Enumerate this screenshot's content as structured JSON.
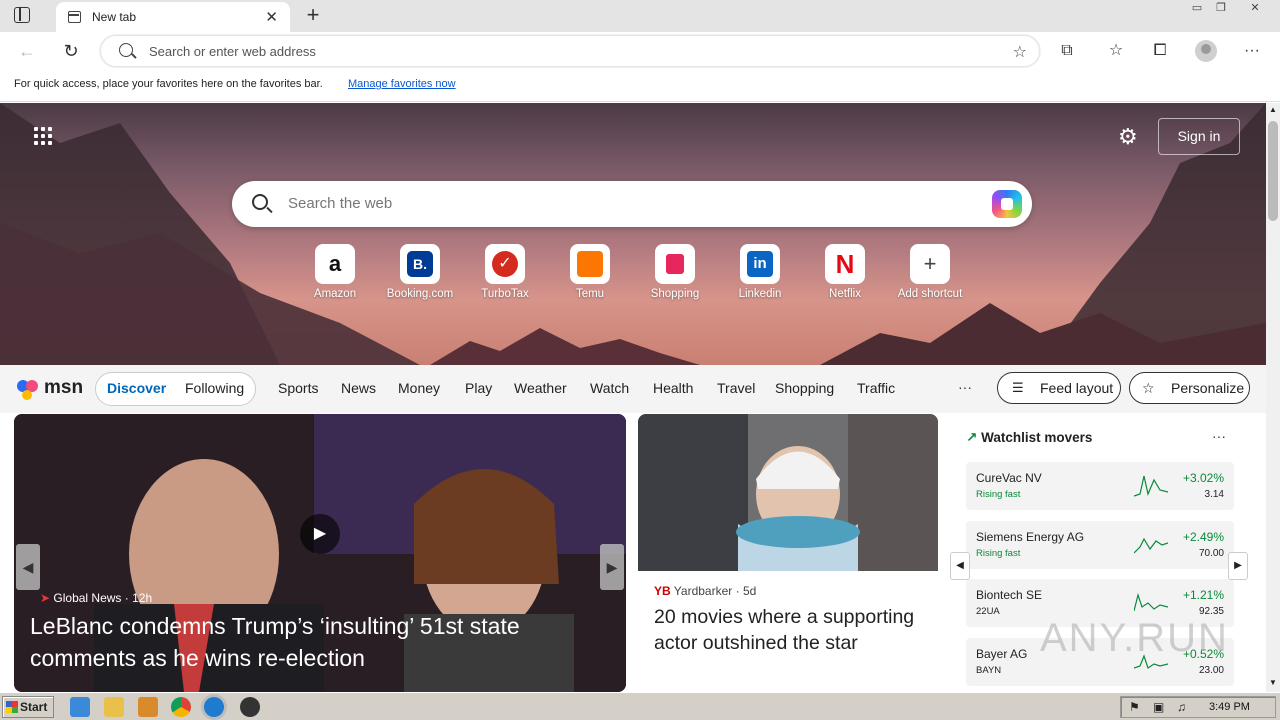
{
  "browser": {
    "tab_title": "New tab",
    "address_placeholder": "Search or enter web address",
    "favorites_message": "For quick access, place your favorites here on the favorites bar.",
    "favorites_link": "Manage favorites now"
  },
  "hero": {
    "signin_label": "Sign in",
    "search_placeholder": "Search the web",
    "shortcuts": [
      {
        "label": "Amazon",
        "icon": "amazon-icon"
      },
      {
        "label": "Booking.com",
        "icon": "booking-icon"
      },
      {
        "label": "TurboTax",
        "icon": "turbotax-icon"
      },
      {
        "label": "Temu",
        "icon": "temu-icon"
      },
      {
        "label": "Shopping",
        "icon": "shopping-bag-icon"
      },
      {
        "label": "Linkedin",
        "icon": "linkedin-icon"
      },
      {
        "label": "Netflix",
        "icon": "netflix-icon"
      },
      {
        "label": "Add shortcut",
        "icon": "plus-icon"
      }
    ]
  },
  "msn": {
    "logo_text": "msn",
    "tabs": [
      "Discover",
      "Following"
    ],
    "nav": [
      "Sports",
      "News",
      "Money",
      "Play",
      "Weather",
      "Watch",
      "Health",
      "Travel",
      "Shopping",
      "Traffic"
    ],
    "more": "···",
    "feed_layout_label": "Feed layout",
    "personalize_label": "Personalize"
  },
  "feed": {
    "main_card": {
      "source": "Global News",
      "age": "12h",
      "headline": "LeBlanc condemns Trump’s ‘insulting’ 51st state comments as he wins re-election"
    },
    "second_card": {
      "source": "Yardbarker",
      "age": "5d",
      "headline": "20 movies where a supporting actor outshined the star"
    },
    "watchlist": {
      "title": "Watchlist movers",
      "items": [
        {
          "name": "CureVac NV",
          "sub": "Rising fast",
          "change": "+3.02%",
          "price": "3.14"
        },
        {
          "name": "Siemens Energy AG",
          "sub": "Rising fast",
          "change": "+2.49%",
          "price": "70.00"
        },
        {
          "name": "Biontech SE",
          "sub": "22UA",
          "change": "+1.21%",
          "price": "92.35"
        },
        {
          "name": "Bayer AG",
          "sub": "BAYN",
          "change": "+0.52%",
          "price": "23.00"
        }
      ],
      "accent": "#0a8a3a"
    }
  },
  "taskbar": {
    "start_label": "Start",
    "clock": "3:49 PM"
  },
  "watermark": "ANY.RUN"
}
